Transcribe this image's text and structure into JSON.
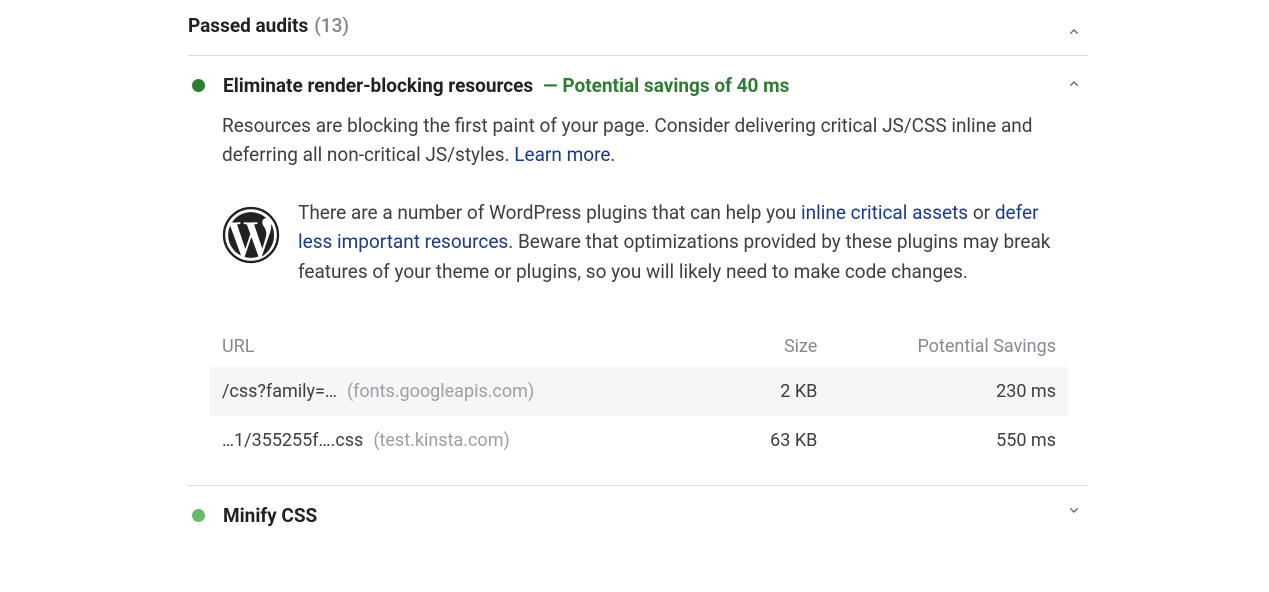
{
  "header": {
    "title": "Passed audits",
    "count": "(13)"
  },
  "audit1": {
    "title": "Eliminate render-blocking resources",
    "savings": "— Potential savings of 40 ms",
    "desc_a": "Resources are blocking the first paint of your page. Consider delivering critical JS/CSS inline and deferring all non-critical JS/styles. ",
    "learn_more": "Learn more",
    "desc_b": ".",
    "wp_a": "There are a number of WordPress plugins that can help you ",
    "wp_link1": "inline critical assets",
    "wp_b": " or ",
    "wp_link2": "defer less important resources",
    "wp_c": ". Beware that optimizations provided by these plugins may break features of your theme or plugins, so you will likely need to make code changes."
  },
  "table": {
    "headers": {
      "url": "URL",
      "size": "Size",
      "savings": "Potential Savings"
    },
    "rows": [
      {
        "path": "/css?family=…",
        "origin": "(fonts.googleapis.com)",
        "size": "2 KB",
        "savings": "230 ms"
      },
      {
        "path": "…1/355255f….css",
        "origin": "(test.kinsta.com)",
        "size": "63 KB",
        "savings": "550 ms"
      }
    ]
  },
  "audit2": {
    "title": "Minify CSS"
  }
}
